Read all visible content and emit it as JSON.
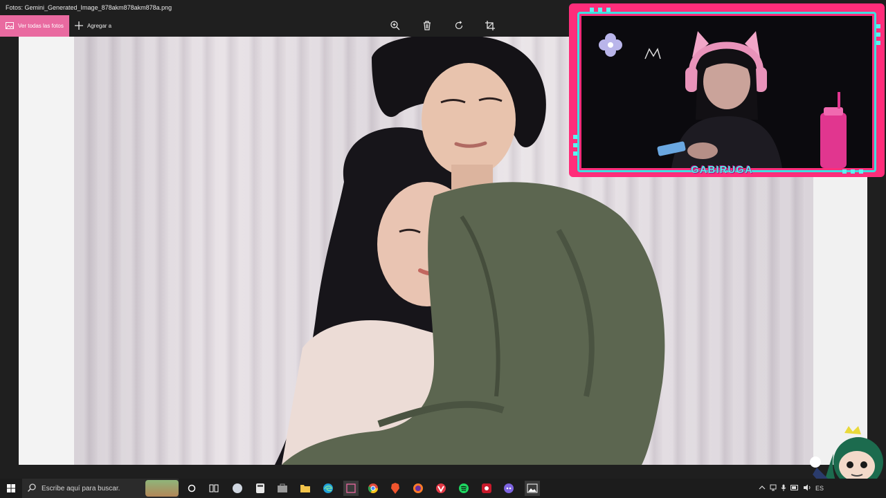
{
  "window": {
    "title": "Fotos: Gemini_Generated_Image_878akm878akm878a.png"
  },
  "toolbar": {
    "view_all_label": "Ver todas las fotos",
    "add_to_label": "Agregar a"
  },
  "overlay": {
    "streamer_name": "GABIRUGA"
  },
  "taskbar": {
    "search_placeholder": "Escribe aquí para buscar.",
    "language": "ES"
  },
  "colors": {
    "accent": "#e96aa0",
    "overlay_frame": "#ff2d7a",
    "overlay_border": "#3de0e0"
  }
}
